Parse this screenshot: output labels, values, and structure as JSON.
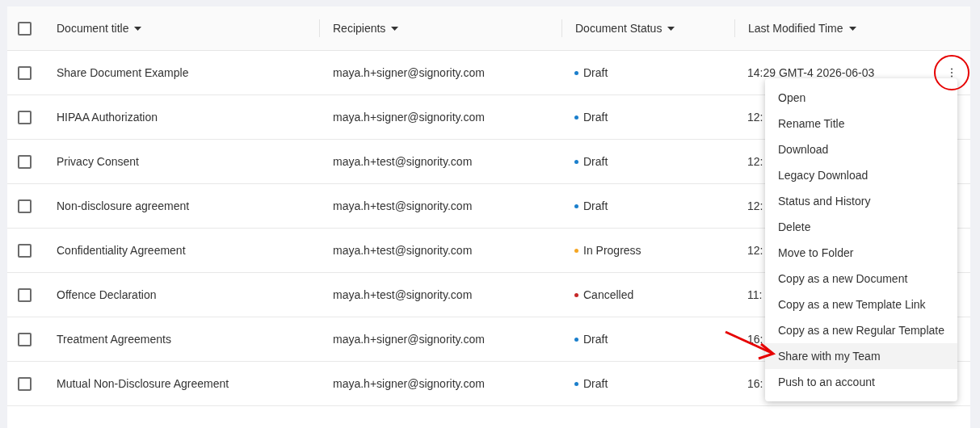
{
  "table": {
    "select_all": {
      "checked": false
    },
    "columns": [
      {
        "label": "Document title"
      },
      {
        "label": "Recipients"
      },
      {
        "label": "Document Status"
      },
      {
        "label": "Last Modified Time"
      }
    ],
    "rows": [
      {
        "checked": false,
        "title": "Share Document Example",
        "recipients": "maya.h+signer@signority.com",
        "status": {
          "label": "Draft",
          "color": "#1b7fcc"
        },
        "time": "14:29 GMT-4 2026-06-03",
        "menu_button": true
      },
      {
        "checked": false,
        "title": "HIPAA Authorization",
        "recipients": "maya.h+signer@signority.com",
        "status": {
          "label": "Draft",
          "color": "#1b7fcc"
        },
        "time": "12:",
        "menu_button": false
      },
      {
        "checked": false,
        "title": "Privacy Consent",
        "recipients": "maya.h+test@signority.com",
        "status": {
          "label": "Draft",
          "color": "#1b7fcc"
        },
        "time": "12:",
        "menu_button": false
      },
      {
        "checked": false,
        "title": "Non-disclosure agreement",
        "recipients": "maya.h+test@signority.com",
        "status": {
          "label": "Draft",
          "color": "#1b7fcc"
        },
        "time": "12:",
        "menu_button": false
      },
      {
        "checked": false,
        "title": "Confidentiality Agreement",
        "recipients": "maya.h+test@signority.com",
        "status": {
          "label": "In Progress",
          "color": "#f5a623"
        },
        "time": "12:",
        "menu_button": false
      },
      {
        "checked": false,
        "title": "Offence Declaration",
        "recipients": "maya.h+test@signority.com",
        "status": {
          "label": "Cancelled",
          "color": "#c62828"
        },
        "time": "11:",
        "menu_button": false
      },
      {
        "checked": false,
        "title": "Treatment Agreements",
        "recipients": "maya.h+signer@signority.com",
        "status": {
          "label": "Draft",
          "color": "#1b7fcc"
        },
        "time": "16:",
        "menu_button": false
      },
      {
        "checked": false,
        "title": "Mutual Non-Disclosure Agreement",
        "recipients": "maya.h+signer@signority.com",
        "status": {
          "label": "Draft",
          "color": "#1b7fcc"
        },
        "time": "16:",
        "menu_button": false
      }
    ]
  },
  "context_menu": {
    "items": [
      {
        "label": "Open",
        "selected": false
      },
      {
        "label": "Rename Title",
        "selected": false
      },
      {
        "label": "Download",
        "selected": false
      },
      {
        "label": "Legacy Download",
        "selected": false
      },
      {
        "label": "Status and History",
        "selected": false
      },
      {
        "label": "Delete",
        "selected": false
      },
      {
        "label": "Move to Folder",
        "selected": false
      },
      {
        "label": "Copy as a new Document",
        "selected": false
      },
      {
        "label": "Copy as a new Template Link",
        "selected": false
      },
      {
        "label": "Copy as a new Regular Template",
        "selected": false
      },
      {
        "label": "Share with my Team",
        "selected": true
      },
      {
        "label": "Push to an account",
        "selected": false
      }
    ]
  }
}
